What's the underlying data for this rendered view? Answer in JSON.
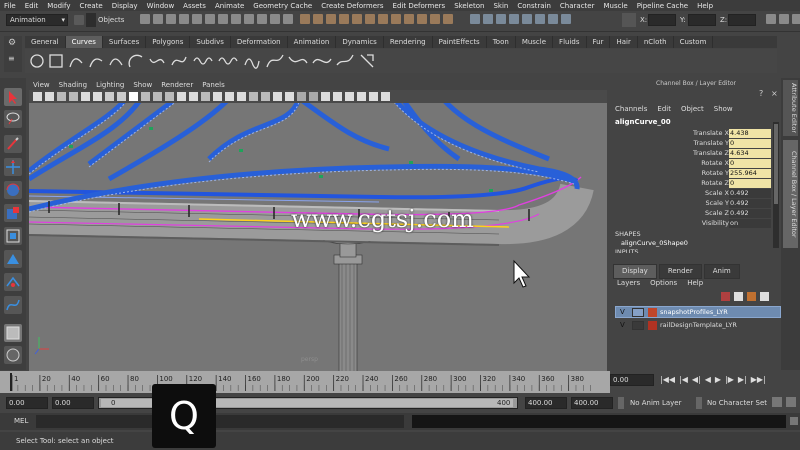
{
  "menubar": [
    "File",
    "Edit",
    "Modify",
    "Create",
    "Display",
    "Window",
    "Assets",
    "Animate",
    "Geometry Cache",
    "Create Deformers",
    "Edit Deformers",
    "Skeleton",
    "Skin",
    "Constrain",
    "Character",
    "Muscle",
    "Pipeline Cache",
    "Help"
  ],
  "status": {
    "mode": "Animation",
    "objects_label": "Objects",
    "x_label": "X:",
    "y_label": "Y:",
    "z_label": "Z:"
  },
  "shelf_tabs": [
    "General",
    "Curves",
    "Surfaces",
    "Polygons",
    "Subdivs",
    "Deformation",
    "Animation",
    "Dynamics",
    "Rendering",
    "PaintEffects",
    "Toon",
    "Muscle",
    "Fluids",
    "Fur",
    "Hair",
    "nCloth",
    "Custom"
  ],
  "active_shelf_tab": "Curves",
  "viewport": {
    "menus": [
      "View",
      "Shading",
      "Lighting",
      "Show",
      "Renderer",
      "Panels"
    ],
    "camera_label": "persp",
    "watermark": "www.cgtsj.com"
  },
  "channel_box": {
    "title": "Channel Box / Layer Editor",
    "menus": [
      "Channels",
      "Edit",
      "Object",
      "Show"
    ],
    "object_name": "alignCurve_00",
    "attributes": [
      {
        "label": "Translate X",
        "value": "4.438"
      },
      {
        "label": "Translate Y",
        "value": "0"
      },
      {
        "label": "Translate Z",
        "value": "4.634"
      },
      {
        "label": "Rotate X",
        "value": "0"
      },
      {
        "label": "Rotate Y",
        "value": "255.964"
      },
      {
        "label": "Rotate Z",
        "value": "0"
      },
      {
        "label": "Scale X",
        "value": "0.492"
      },
      {
        "label": "Scale Y",
        "value": "0.492"
      },
      {
        "label": "Scale Z",
        "value": "0.492"
      },
      {
        "label": "Visibility",
        "value": "on"
      }
    ],
    "shapes_header": "SHAPES",
    "shape_name": "alignCurve_0Shape0",
    "inputs_header": "INPUTS"
  },
  "layer_editor": {
    "tabs": [
      "Display",
      "Render",
      "Anim"
    ],
    "active_tab": "Display",
    "menus": [
      "Layers",
      "Options",
      "Help"
    ],
    "layers": [
      {
        "v": "V",
        "name": "snapshotProfiles_LYR",
        "selected": true,
        "color": "#c0462a"
      },
      {
        "v": "V",
        "name": "railDesignTemplate_LYR",
        "selected": false,
        "color": "#b03222"
      }
    ]
  },
  "side_tabs": [
    "Attribute Editor",
    "Channel Box / Layer Editor"
  ],
  "timeline": {
    "ticks": [
      "1",
      "20",
      "40",
      "60",
      "80",
      "100",
      "120",
      "140",
      "160",
      "180",
      "200",
      "220",
      "240",
      "260",
      "280",
      "300",
      "320",
      "340",
      "360",
      "380"
    ],
    "current_frame": "0.00"
  },
  "range": {
    "start": "0.00",
    "playback_start": "0.00",
    "range_start_marker": "0",
    "range_end_marker": "400",
    "playback_end": "400.00",
    "end": "400.00",
    "anim_layer": "No Anim Layer",
    "character_set": "No Character Set"
  },
  "command_line": {
    "label": "MEL"
  },
  "help_line": "Select Tool: select an object",
  "overlay_key": "Q"
}
